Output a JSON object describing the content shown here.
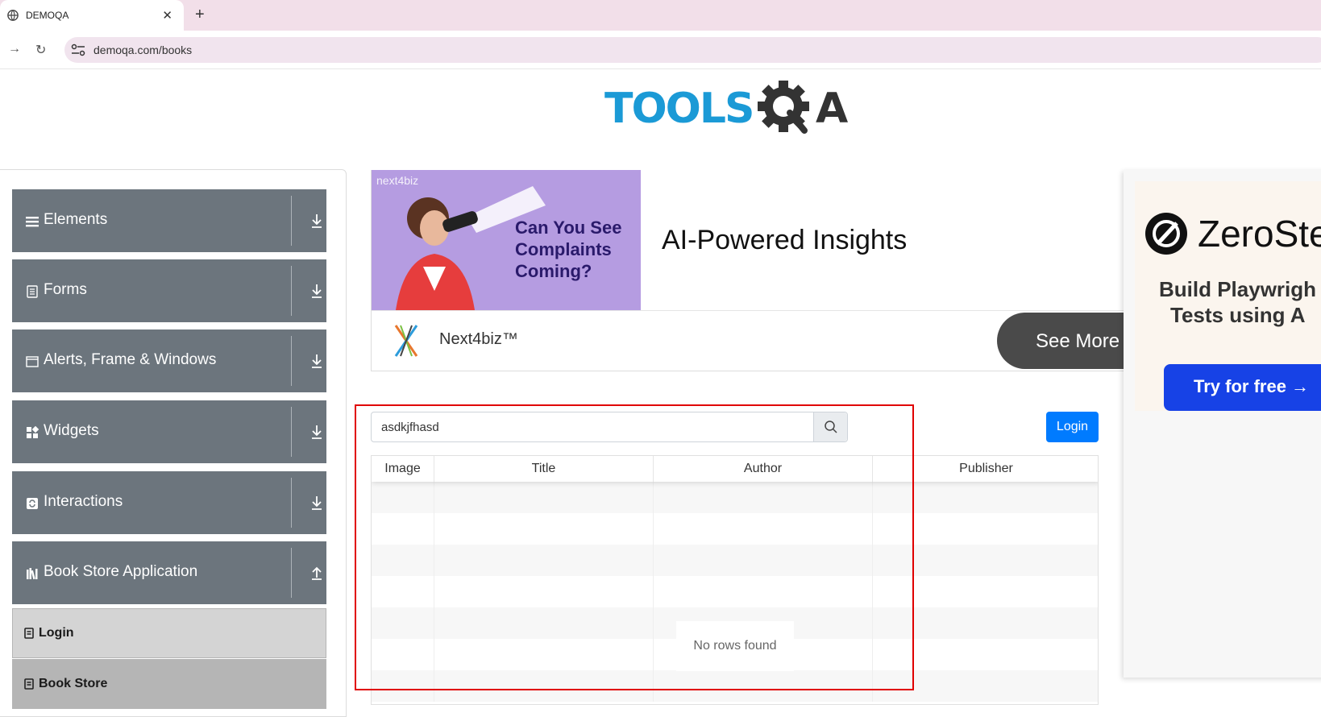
{
  "browser": {
    "tab_title": "DEMOQA",
    "url": "demoqa.com/books"
  },
  "logo": {
    "text_tools": "TOOLS",
    "text_qa": "A"
  },
  "sidebar": {
    "groups": [
      {
        "label": "Elements",
        "icon": "hamburger-icon",
        "arrow": "download-arrow-icon"
      },
      {
        "label": "Forms",
        "icon": "document-icon",
        "arrow": "download-arrow-icon"
      },
      {
        "label": "Alerts, Frame & Windows",
        "icon": "window-icon",
        "arrow": "download-arrow-icon"
      },
      {
        "label": "Widgets",
        "icon": "widgets-icon",
        "arrow": "download-arrow-icon"
      },
      {
        "label": "Interactions",
        "icon": "interactions-icon",
        "arrow": "download-arrow-icon"
      },
      {
        "label": "Book Store Application",
        "icon": "books-icon",
        "arrow": "upload-arrow-icon"
      }
    ],
    "subitems": [
      {
        "label": "Login"
      },
      {
        "label": "Book Store"
      }
    ]
  },
  "ad": {
    "small_brand": "next4biz",
    "image_text": "Can You See Complaints Coming?",
    "headline": "AI-Powered Insights",
    "brand": "Next4biz™",
    "cta": "See More"
  },
  "right_ad": {
    "name": "ZeroSte",
    "body_line1": "Build Playwrigh",
    "body_line2": "Tests using A",
    "button": "Try for free →"
  },
  "search": {
    "value": "asdkjfhasd"
  },
  "login_button": "Login",
  "table": {
    "headers": [
      "Image",
      "Title",
      "Author",
      "Publisher"
    ],
    "empty_message": "No rows found"
  },
  "colors": {
    "sidebar_group": "#6c757d",
    "primary": "#007bff",
    "highlight_frame": "#e00000"
  }
}
